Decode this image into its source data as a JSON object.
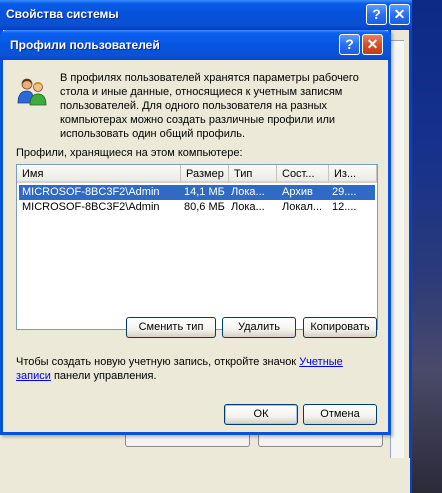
{
  "back_window": {
    "title": "Свойства системы",
    "help_glyph": "?",
    "close_glyph": "✕"
  },
  "dialog": {
    "title": "Профили пользователей",
    "help_glyph": "?",
    "close_glyph": "✕",
    "description": "В профилях пользователей хранятся параметры рабочего стола и иные данные, относящиеся к учетным записям пользователей. Для одного пользователя на разных компьютерах можно создать различные профили или использовать один общий профиль.",
    "profiles_label": "Профили, хранящиеся на этом компьютере:",
    "columns": [
      "Имя",
      "Размер",
      "Тип",
      "Сост...",
      "Из..."
    ],
    "rows": [
      {
        "name": "MICROSOF-8BC3F2\\Admin",
        "size": "14,1 МБ",
        "type": "Лока...",
        "state": "Архив",
        "modified": "29....",
        "selected": true
      },
      {
        "name": "MICROSOF-8BC3F2\\Admin",
        "size": "80,6 МБ",
        "type": "Лока...",
        "state": "Локал...",
        "modified": "12....",
        "selected": false
      }
    ],
    "buttons": {
      "change_type": "Сменить тип",
      "delete": "Удалить",
      "copy": "Копировать",
      "ok": "ОК",
      "cancel": "Отмена"
    },
    "footer_text_before": "Чтобы создать новую учетную запись, откройте значок ",
    "footer_link": "Учетные записи",
    "footer_text_after": " панели управления."
  },
  "colors": {
    "titlebar_blue": "#0553dd",
    "selection": "#316ac5",
    "window_bg": "#ece9d8",
    "close_red": "#d4502c"
  },
  "icons": {
    "users": "users-icon"
  }
}
